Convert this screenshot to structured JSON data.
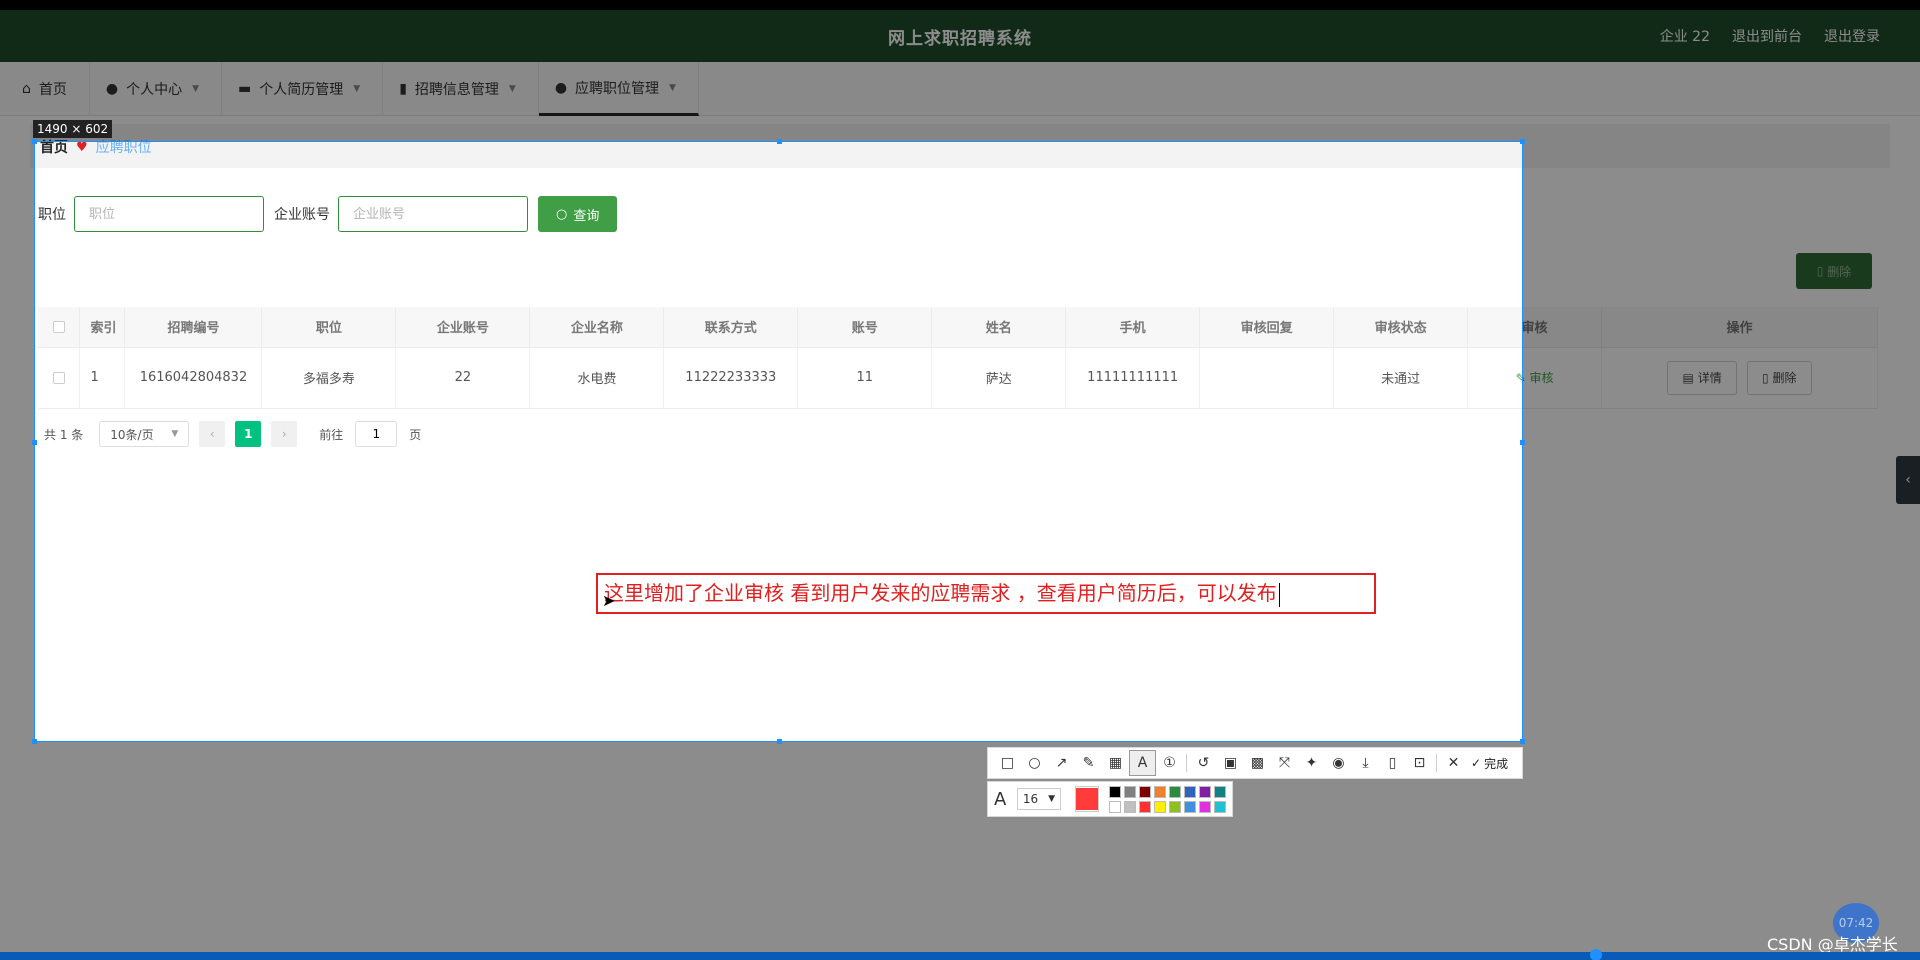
{
  "header": {
    "title": "网上求职招聘系统",
    "links": [
      "企业 22",
      "退出到前台",
      "退出登录"
    ]
  },
  "menu": {
    "items": [
      {
        "label": "首页",
        "icon": "home-icon"
      },
      {
        "label": "个人中心",
        "icon": "user-icon"
      },
      {
        "label": "个人简历管理",
        "icon": "briefcase-icon"
      },
      {
        "label": "招聘信息管理",
        "icon": "clipboard-icon"
      },
      {
        "label": "应聘职位管理",
        "icon": "location-pin-icon"
      }
    ]
  },
  "breadcrumb": {
    "home": "首页",
    "current": "应聘职位"
  },
  "search": {
    "position_label": "职位",
    "position_placeholder": "职位",
    "company_label": "企业账号",
    "company_placeholder": "企业账号",
    "query_button": "查询"
  },
  "delete_button": "删除",
  "table": {
    "headers": [
      "索引",
      "招聘编号",
      "职位",
      "企业账号",
      "企业名称",
      "联系方式",
      "账号",
      "姓名",
      "手机",
      "审核回复",
      "审核状态",
      "审核",
      "操作"
    ],
    "rows": [
      {
        "index": "1",
        "recruit_no": "1616042804832",
        "position": "多福多寿",
        "company_account": "22",
        "company_name": "水电费",
        "contact": "11222233333",
        "account": "11",
        "name": "萨达",
        "phone": "11111111111",
        "reply": "",
        "status": "未通过",
        "audit": "审核",
        "detail": "详情",
        "delete": "删除"
      }
    ]
  },
  "pagination": {
    "total": "共 1 条",
    "page_size": "10条/页",
    "current": "1",
    "goto_prefix": "前往",
    "goto_value": "1",
    "goto_suffix": "页"
  },
  "capture": {
    "dimensions": "1490 × 602",
    "annotation": "这里增加了企业审核   看到用户发来的应聘需求 ，查看用户简历后，可以发布",
    "font_size": "16",
    "done": "完成",
    "current_color": "#ff3b3b",
    "palette": [
      "#000000",
      "#808080",
      "#800000",
      "#f08030",
      "#2e8b3d",
      "#3060c0",
      "#8020a0",
      "#108080",
      "#ffffff",
      "#c0c0c0",
      "#ff3030",
      "#ffee00",
      "#90c020",
      "#4090e0",
      "#e030e0",
      "#20c0d0"
    ]
  },
  "watermark": "CSDN @卓杰学长",
  "clock": "07:42"
}
